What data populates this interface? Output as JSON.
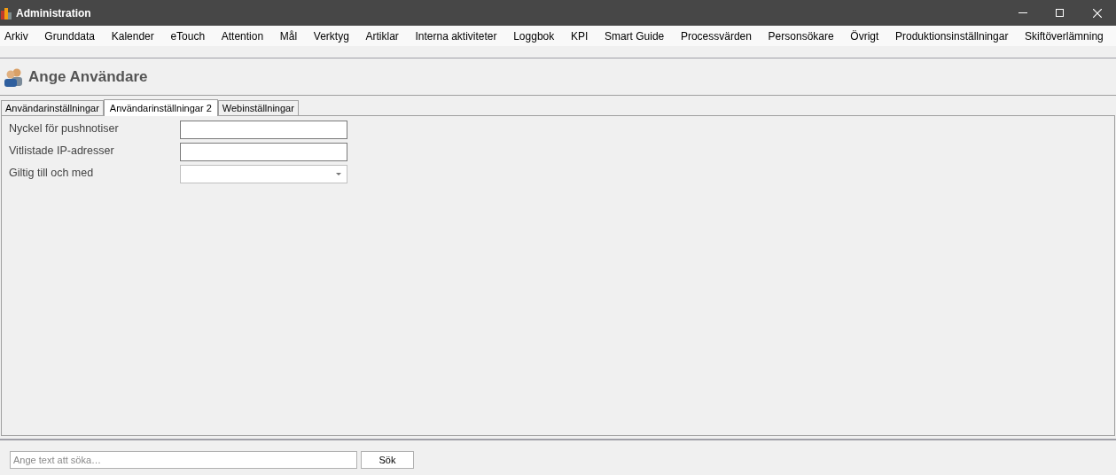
{
  "window": {
    "title": "Administration"
  },
  "menu": [
    "Arkiv",
    "Grunddata",
    "Kalender",
    "eTouch",
    "Attention",
    "Mål",
    "Verktyg",
    "Artiklar",
    "Interna aktiviteter",
    "Loggbok",
    "KPI",
    "Smart Guide",
    "Processvärden",
    "Personsökare",
    "Övrigt",
    "Produktionsinställningar",
    "Skiftöverlämning"
  ],
  "page_title": "Ange Användare",
  "tabs": [
    {
      "label": "Användarinställningar",
      "selected": false
    },
    {
      "label": "Användarinställningar 2",
      "selected": true
    },
    {
      "label": "Webinställningar",
      "selected": false
    }
  ],
  "fields": [
    {
      "label": "Nyckel för pushnotiser",
      "kind": "text"
    },
    {
      "label": "Vitlistade IP-adresser",
      "kind": "text"
    },
    {
      "label": "Giltig till och med",
      "kind": "dropdown"
    }
  ],
  "search": {
    "placeholder": "Ange text att söka…",
    "button": "Sök"
  }
}
